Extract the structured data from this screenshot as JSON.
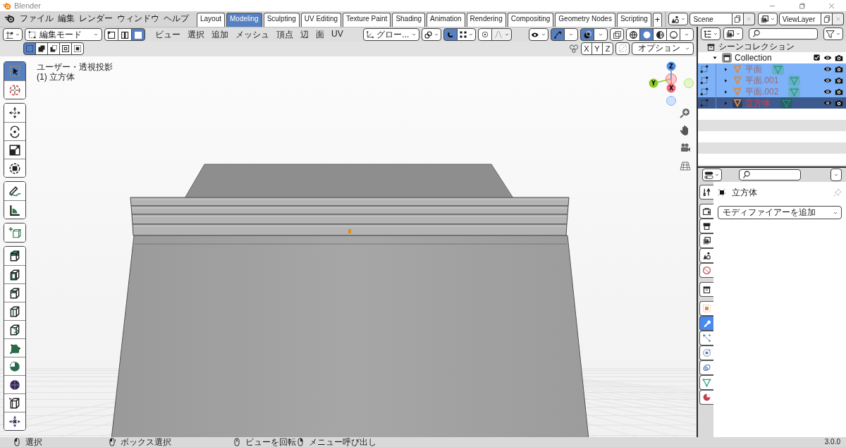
{
  "window": {
    "title": "Blender"
  },
  "menu": [
    "ファイル",
    "編集",
    "レンダー",
    "ウィンドウ",
    "ヘルプ"
  ],
  "workspaces": [
    {
      "label": "Layout",
      "selected": false
    },
    {
      "label": "Modeling",
      "selected": true
    },
    {
      "label": "Sculpting",
      "selected": false
    },
    {
      "label": "UV Editing",
      "selected": false
    },
    {
      "label": "Texture Paint",
      "selected": false
    },
    {
      "label": "Shading",
      "selected": false
    },
    {
      "label": "Animation",
      "selected": false
    },
    {
      "label": "Rendering",
      "selected": false
    },
    {
      "label": "Compositing",
      "selected": false
    },
    {
      "label": "Geometry Nodes",
      "selected": false
    },
    {
      "label": "Scripting",
      "selected": false
    }
  ],
  "add_workspace": "+",
  "scene": "Scene",
  "view_layer": "ViewLayer",
  "viewport": {
    "mode": "編集モード",
    "select_modes": [
      {
        "kind": "vertex",
        "selected": false
      },
      {
        "kind": "edge",
        "selected": false
      },
      {
        "kind": "face",
        "selected": true
      }
    ],
    "menus": [
      "ビュー",
      "選択",
      "追加",
      "メッシュ",
      "頂点",
      "辺",
      "面",
      "UV"
    ],
    "orientation": "グロー...",
    "snap": {
      "on": true
    },
    "proportional": {
      "on": false
    },
    "gizmos": {
      "on": true
    },
    "overlays": {
      "on": true
    },
    "xray": {
      "on": false
    },
    "shading": [
      {
        "kind": "wireframe",
        "selected": false
      },
      {
        "kind": "solid",
        "selected": true
      },
      {
        "kind": "material",
        "selected": false
      },
      {
        "kind": "rendered",
        "selected": false
      }
    ],
    "selection_ops": [
      {
        "kind": "set",
        "selected": true
      },
      {
        "kind": "extend",
        "selected": false
      },
      {
        "kind": "subtract",
        "selected": false
      },
      {
        "kind": "invert",
        "selected": false
      },
      {
        "kind": "intersect",
        "selected": false
      }
    ],
    "mirror": [
      {
        "label": "X",
        "on": false
      },
      {
        "label": "Y",
        "on": false
      },
      {
        "label": "Z",
        "on": false
      }
    ],
    "options": "オプション",
    "view_name": "ユーザー・透視投影",
    "object_name": "(1) 立方体",
    "axes": [
      {
        "label": "Z",
        "color": "#4f8fe6"
      },
      {
        "label": "Y",
        "color": "#8acb28"
      },
      {
        "label": "X",
        "color": "#f06b7d"
      }
    ],
    "tool_groups": [
      [
        {
          "kind": "select_box",
          "selected": true
        },
        {
          "kind": "cursor",
          "selected": false
        }
      ],
      [
        {
          "kind": "move",
          "selected": false
        },
        {
          "kind": "rotate",
          "selected": false
        },
        {
          "kind": "scale",
          "selected": false
        },
        {
          "kind": "transform",
          "selected": false
        }
      ],
      [
        {
          "kind": "annotate",
          "selected": false
        },
        {
          "kind": "measure",
          "selected": false
        }
      ],
      [
        {
          "kind": "add_cube",
          "selected": false
        }
      ],
      [
        {
          "kind": "extrude",
          "selected": false
        },
        {
          "kind": "inset",
          "selected": false
        },
        {
          "kind": "bevel",
          "selected": false
        },
        {
          "kind": "loop_cut",
          "selected": false
        },
        {
          "kind": "knife",
          "selected": false
        },
        {
          "kind": "poly_build",
          "selected": false
        },
        {
          "kind": "spin",
          "selected": false
        },
        {
          "kind": "smooth",
          "selected": false
        },
        {
          "kind": "edge_slide",
          "selected": false
        },
        {
          "kind": "shrink",
          "selected": false
        }
      ]
    ]
  },
  "outliner": {
    "scene_collection": "シーンコレクション",
    "collection": {
      "name": "Collection",
      "expanded": true,
      "checked": true,
      "children": [
        {
          "name": "平面",
          "selected": true,
          "active": false
        },
        {
          "name": "平面.001",
          "selected": true,
          "active": false
        },
        {
          "name": "平面.002",
          "selected": true,
          "active": false
        },
        {
          "name": "立方体",
          "selected": true,
          "active": true
        }
      ]
    }
  },
  "properties": {
    "tab_groups": [
      [
        {
          "kind": "tool",
          "selected": false
        }
      ],
      [
        {
          "kind": "render",
          "selected": false
        },
        {
          "kind": "output",
          "selected": false
        },
        {
          "kind": "view_layer",
          "selected": false
        },
        {
          "kind": "scene",
          "selected": false
        },
        {
          "kind": "world",
          "selected": false
        }
      ],
      [
        {
          "kind": "collection",
          "selected": false
        }
      ],
      [
        {
          "kind": "object",
          "selected": false
        },
        {
          "kind": "modifiers",
          "selected": true
        },
        {
          "kind": "particles",
          "selected": false
        },
        {
          "kind": "physics",
          "selected": false
        },
        {
          "kind": "constraints",
          "selected": false
        },
        {
          "kind": "data",
          "selected": false
        },
        {
          "kind": "material",
          "selected": false
        }
      ]
    ],
    "object": "立方体",
    "add_modifier": "モディファイアーを追加"
  },
  "status": {
    "items": [
      {
        "kind": "left_mouse",
        "label": "選択"
      },
      {
        "kind": "drag",
        "label": "ボックス選択"
      },
      {
        "kind": "middle_mouse",
        "label": "ビューを回転"
      },
      {
        "kind": "right_mouse",
        "label": "メニュー呼び出し"
      }
    ],
    "version": "3.0.0"
  }
}
